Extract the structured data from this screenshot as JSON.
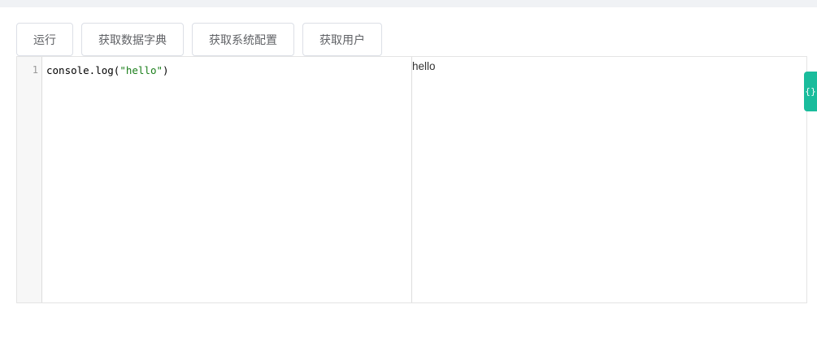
{
  "toolbar": {
    "run_label": "运行",
    "dict_label": "获取数据字典",
    "config_label": "获取系统配置",
    "user_label": "获取用户"
  },
  "editor": {
    "line_numbers": [
      "1"
    ],
    "code": {
      "prefix": "console.log(",
      "string": "\"hello\"",
      "suffix": ")"
    }
  },
  "output": {
    "text": "hello"
  },
  "side_tab": {
    "icon": "gear-icon",
    "glyph": "{}"
  },
  "colors": {
    "accent": "#1abc9c",
    "string_token": "#1a7e1a",
    "button_text": "#606266",
    "border": "#dcdfe6"
  }
}
